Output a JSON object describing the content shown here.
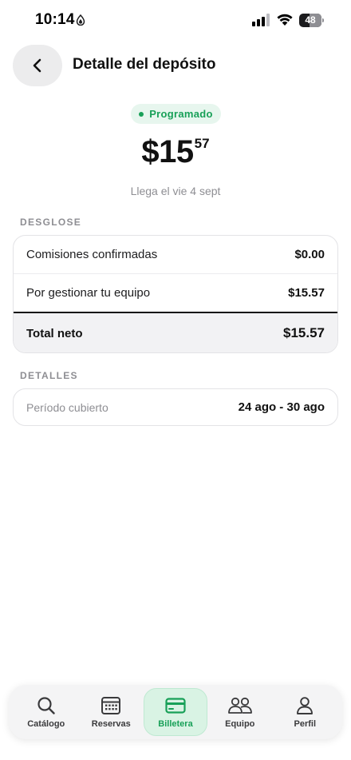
{
  "status_bar": {
    "time": "10:14",
    "battery": "48",
    "battery_level": 0.48
  },
  "header": {
    "title": "Detalle del depósito"
  },
  "deposit": {
    "status": "Programado",
    "status_color": "#18a058",
    "amount_whole": "$15",
    "amount_cents": "57",
    "arrival": "Llega el vie 4 sept"
  },
  "breakdown": {
    "section_title": "DESGLOSE",
    "rows": [
      {
        "label": "Comisiones confirmadas",
        "value": "$0.00"
      },
      {
        "label": "Por gestionar tu equipo",
        "value": "$15.57"
      }
    ],
    "total": {
      "label": "Total neto",
      "value": "$15.57"
    }
  },
  "details": {
    "section_title": "DETALLES",
    "rows": [
      {
        "label": "Período cubierto",
        "value": "24 ago - 30 ago"
      }
    ]
  },
  "bottom_nav": {
    "active_index": 2,
    "items": [
      {
        "label": "Catálogo",
        "icon": "search-icon"
      },
      {
        "label": "Reservas",
        "icon": "calendar-icon"
      },
      {
        "label": "Billetera",
        "icon": "wallet-card-icon"
      },
      {
        "label": "Equipo",
        "icon": "team-icon"
      },
      {
        "label": "Perfil",
        "icon": "person-icon"
      }
    ]
  }
}
